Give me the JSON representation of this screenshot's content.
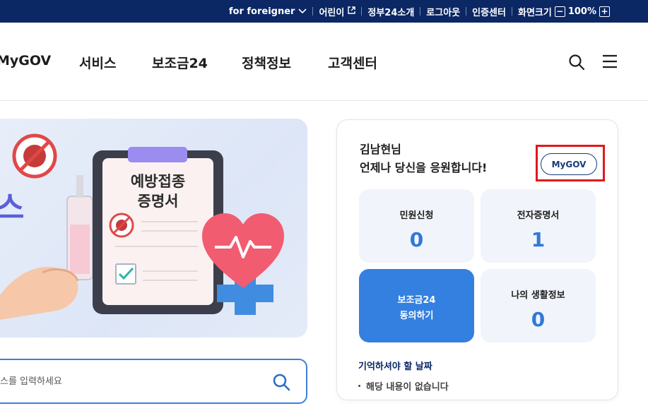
{
  "topbar": {
    "items": [
      {
        "label": "for foreigner",
        "icon": "chevron-down-icon"
      },
      {
        "label": "어린이",
        "icon": "external-link-icon"
      },
      {
        "label": "정부24소개"
      },
      {
        "label": "로그아웃"
      },
      {
        "label": "인증센터"
      },
      {
        "label": "화면크기"
      }
    ],
    "zoom": "100%",
    "zoom_minus": "−",
    "zoom_plus": "+"
  },
  "nav": {
    "items": [
      "MyGOV",
      "서비스",
      "보조금24",
      "정책정보",
      "고객센터"
    ],
    "search_icon": "search-icon",
    "menu_icon": "hamburger-menu-icon"
  },
  "hero": {
    "text": "스",
    "paper_title_line1": "예방접종",
    "paper_title_line2": "증명서"
  },
  "search": {
    "placeholder": "스를 입력하세요"
  },
  "user_card": {
    "name": "김남현님",
    "message": "언제나 당신을 응원합니다!",
    "mygov_button": "MyGOV",
    "tiles": [
      {
        "label": "민원신청",
        "value": "0"
      },
      {
        "label": "전자증명서",
        "value": "1"
      },
      {
        "label": "보조금24 동의하기"
      },
      {
        "label": "나의 생활정보",
        "value": "0"
      }
    ],
    "tile_action_line1": "보조금24",
    "tile_action_line2": "동의하기",
    "remember_title": "기억하셔야 할 날짜",
    "remember_empty": "해당 내용이 없습니다"
  },
  "colors": {
    "topbar_bg": "#0b2764",
    "accent_blue": "#3380e0",
    "value_blue": "#2f79d8",
    "highlight_red": "#e0181e"
  }
}
